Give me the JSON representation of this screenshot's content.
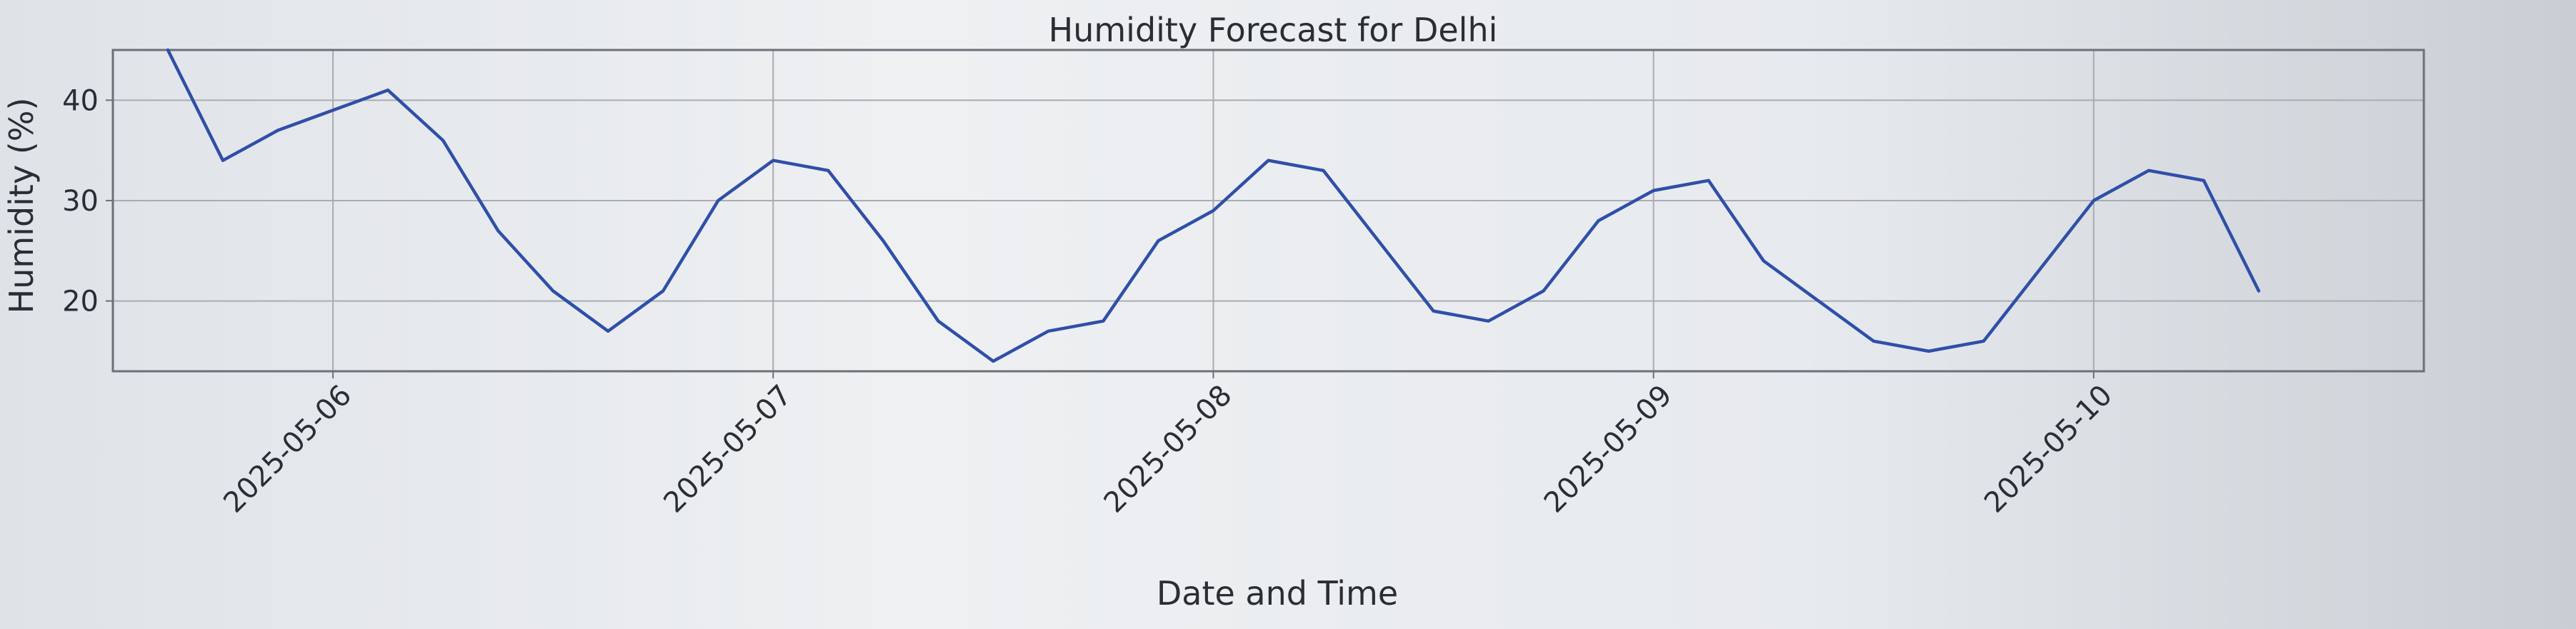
{
  "chart_data": {
    "type": "line",
    "title": "Humidity Forecast for Delhi",
    "xlabel": "Date and Time",
    "ylabel": "Humidity (%)",
    "x_tick_labels": [
      "2025-05-06",
      "2025-05-07",
      "2025-05-08",
      "2025-05-09",
      "2025-05-10"
    ],
    "y_ticks": [
      20,
      30,
      40
    ],
    "x_range": [
      "2025-05-05 12:00",
      "2025-05-10 18:00"
    ],
    "ylim": [
      13,
      45
    ],
    "grid": true,
    "colors": {
      "line": "#2f4fa8",
      "grid": "#a9acb1",
      "axes": "#6d7077"
    },
    "series": [
      {
        "x": [
          "2025-05-05 15:00",
          "2025-05-05 18:00",
          "2025-05-05 21:00",
          "2025-05-06 00:00",
          "2025-05-06 03:00",
          "2025-05-06 06:00",
          "2025-05-06 09:00",
          "2025-05-06 12:00",
          "2025-05-06 15:00",
          "2025-05-06 18:00",
          "2025-05-06 21:00",
          "2025-05-07 00:00",
          "2025-05-07 03:00",
          "2025-05-07 06:00",
          "2025-05-07 09:00",
          "2025-05-07 12:00",
          "2025-05-07 15:00",
          "2025-05-07 18:00",
          "2025-05-07 21:00",
          "2025-05-08 00:00",
          "2025-05-08 03:00",
          "2025-05-08 06:00",
          "2025-05-08 09:00",
          "2025-05-08 12:00",
          "2025-05-08 15:00",
          "2025-05-08 18:00",
          "2025-05-08 21:00",
          "2025-05-09 00:00",
          "2025-05-09 03:00",
          "2025-05-09 06:00",
          "2025-05-09 09:00",
          "2025-05-09 12:00",
          "2025-05-09 15:00",
          "2025-05-09 18:00",
          "2025-05-09 21:00",
          "2025-05-10 00:00",
          "2025-05-10 03:00",
          "2025-05-10 06:00",
          "2025-05-10 09:00"
        ],
        "y": [
          45,
          34,
          37,
          39,
          41,
          36,
          27,
          21,
          17,
          21,
          30,
          34,
          33,
          26,
          18,
          14,
          17,
          18,
          26,
          29,
          34,
          33,
          26,
          19,
          18,
          21,
          28,
          31,
          32,
          24,
          20,
          16,
          15,
          16,
          23,
          30,
          33,
          32,
          21
        ]
      }
    ]
  }
}
